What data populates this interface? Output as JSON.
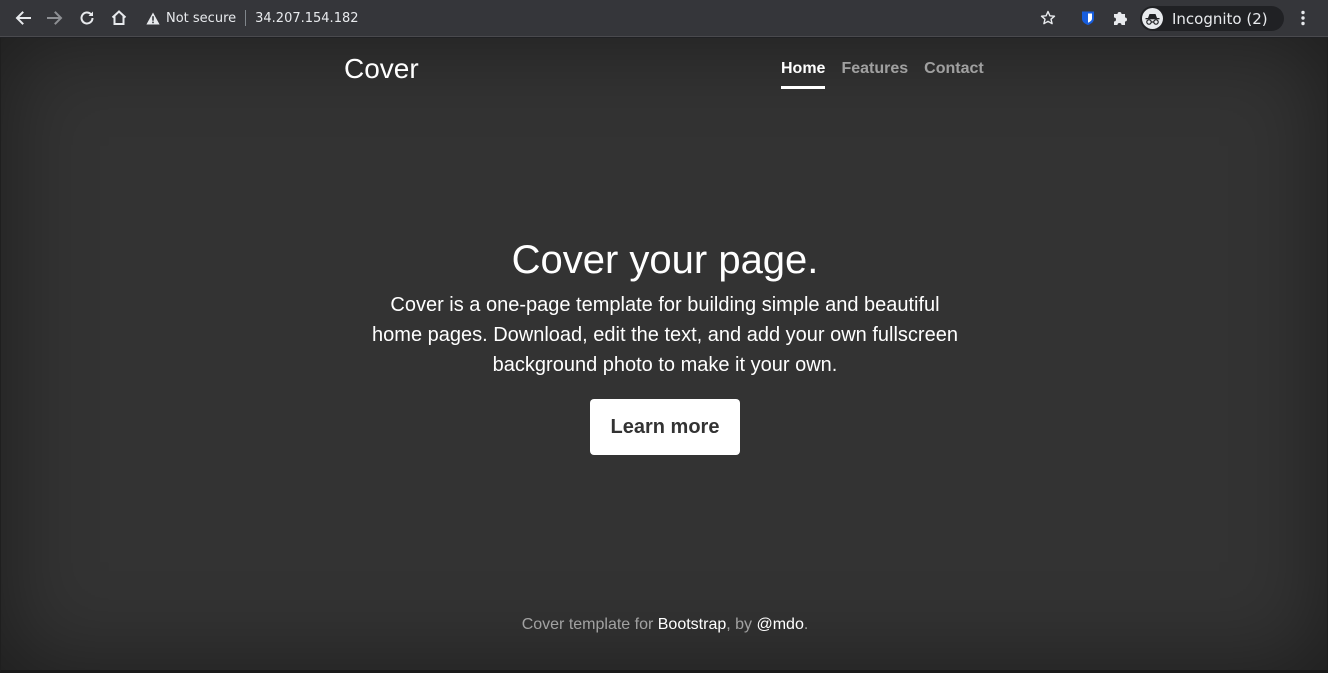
{
  "browser": {
    "security_label": "Not secure",
    "url": "34.207.154.182",
    "profile_label": "Incognito (2)",
    "icons": [
      "back-icon",
      "forward-icon",
      "reload-icon",
      "home-icon",
      "warning-icon",
      "star-icon",
      "bitwarden-icon",
      "extensions-icon",
      "incognito-icon",
      "menu-icon"
    ]
  },
  "page": {
    "brand": "Cover",
    "nav": [
      {
        "label": "Home"
      },
      {
        "label": "Features"
      },
      {
        "label": "Contact"
      }
    ],
    "hero": {
      "title": "Cover your page.",
      "lead": "Cover is a one-page template for building simple and beautiful home pages. Download, edit the text, and add your own fullscreen background photo to make it your own.",
      "button_label": "Learn more"
    },
    "footer": {
      "prefix": "Cover template for ",
      "link1": "Bootstrap",
      "middle": ", by ",
      "link2": "@mdo",
      "suffix": "."
    }
  },
  "colors": {
    "page_bg": "#333333",
    "toolbar_bg": "#35363a",
    "text": "#ffffff",
    "muted_text": "rgba(255,255,255,0.55)",
    "button_bg": "#ffffff",
    "bitwarden_blue": "#175ddc"
  }
}
